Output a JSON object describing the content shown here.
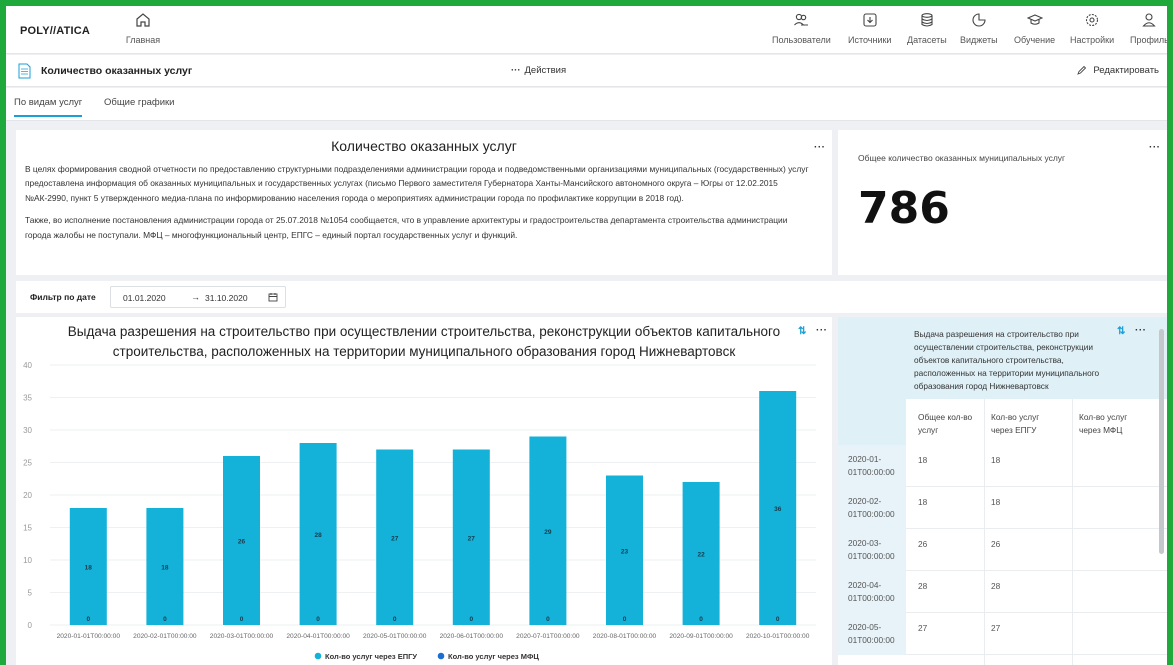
{
  "app": {
    "logo": "POLY//ATICA",
    "home_label": "Главная",
    "nav": [
      {
        "label": "Пользователи",
        "icon": "users-icon"
      },
      {
        "label": "Источники",
        "icon": "sources-icon"
      },
      {
        "label": "Датасеты",
        "icon": "datasets-icon"
      },
      {
        "label": "Виджеты",
        "icon": "widgets-icon"
      },
      {
        "label": "Обучение",
        "icon": "graduation-cap-icon"
      },
      {
        "label": "Настройки",
        "icon": "gear-icon"
      },
      {
        "label": "Профиль",
        "icon": "profile-icon"
      }
    ]
  },
  "page": {
    "title": "Количество оказанных услуг",
    "actions_label": "Действия",
    "edit_label": "Редактировать"
  },
  "tabs": [
    "По видам услуг",
    "Общие графики"
  ],
  "description": {
    "title": "Количество оказанных услуг",
    "paragraph1": "В целях формирования сводной отчетности по предоставлению структурными подразделениями администрации города и подведомственными организациями муниципальных (государственных) услуг предоставлена информация об оказанных муниципальных и государственных услугах (письмо Первого заместителя Губернатора Ханты-Мансийского автономного округа – Югры от 12.02.2015 №АК-2990, пункт 5 утвержденного медиа-плана по информированию населения города о мероприятиях администрации города по профилактике коррупции в 2018 год).",
    "paragraph2": "Также, во исполнение постановления администрации города от 25.07.2018 №1054 сообщается, что в управление архитектуры и градостроительства департамента строительства администрации города жалобы не поступали. МФЦ – многофункциональный центр, ЕПГС – единый портал государственных услуг и функций."
  },
  "kpi": {
    "label": "Общее количество оказанных муниципальных услуг",
    "value": "786"
  },
  "filter": {
    "label": "Фильтр по дате",
    "from": "01.01.2020",
    "arrow": "→",
    "to": "31.10.2020"
  },
  "chart_data": {
    "type": "bar",
    "title": "Выдача разрешения на строительство при осуществлении строительства, реконструкции объектов капитального строительства, расположенных на территории муниципального образования город Нижневартовск",
    "title_lines": [
      "Выдача разрешения на строительство при осуществлении строительства, реконструкции объектов капитального",
      "строительства, расположенных на территории муниципального образования город Нижневартовск"
    ],
    "categories": [
      "2020-01-01T00:00:00",
      "2020-02-01T00:00:00",
      "2020-03-01T00:00:00",
      "2020-04-01T00:00:00",
      "2020-05-01T00:00:00",
      "2020-06-01T00:00:00",
      "2020-07-01T00:00:00",
      "2020-08-01T00:00:00",
      "2020-09-01T00:00:00",
      "2020-10-01T00:00:00"
    ],
    "series": [
      {
        "name": "Кол-во услуг через ЕПГУ",
        "color": "#14b1d8",
        "values": [
          18,
          18,
          26,
          28,
          27,
          27,
          29,
          23,
          22,
          36
        ]
      },
      {
        "name": "Кол-во услуг через МФЦ",
        "color": "#1c6fd1",
        "values": [
          0,
          0,
          0,
          0,
          0,
          0,
          0,
          0,
          0,
          0
        ]
      }
    ],
    "ylim": [
      0,
      40
    ],
    "yticks": [
      0,
      5,
      10,
      15,
      20,
      25,
      30,
      35,
      40
    ],
    "stacked": true,
    "legend": "bottom"
  },
  "table": {
    "title": "Выдача разрешения на строительство при осуществлении строительства, реконструкции объектов капитального строительства, расположенных на территории муниципального образования город Нижневартовск",
    "columns": [
      "Общее кол-во услуг",
      "Кол-во услуг через ЕПГУ",
      "Кол-во услуг через МФЦ"
    ],
    "rows": [
      {
        "date": "2020-01-01T00:00:00",
        "total": "18",
        "epgu": "18",
        "mfc": ""
      },
      {
        "date": "2020-02-01T00:00:00",
        "total": "18",
        "epgu": "18",
        "mfc": ""
      },
      {
        "date": "2020-03-01T00:00:00",
        "total": "26",
        "epgu": "26",
        "mfc": ""
      },
      {
        "date": "2020-04-01T00:00:00",
        "total": "28",
        "epgu": "28",
        "mfc": ""
      },
      {
        "date": "2020-05-01T00:00:00",
        "total": "27",
        "epgu": "27",
        "mfc": ""
      }
    ]
  }
}
